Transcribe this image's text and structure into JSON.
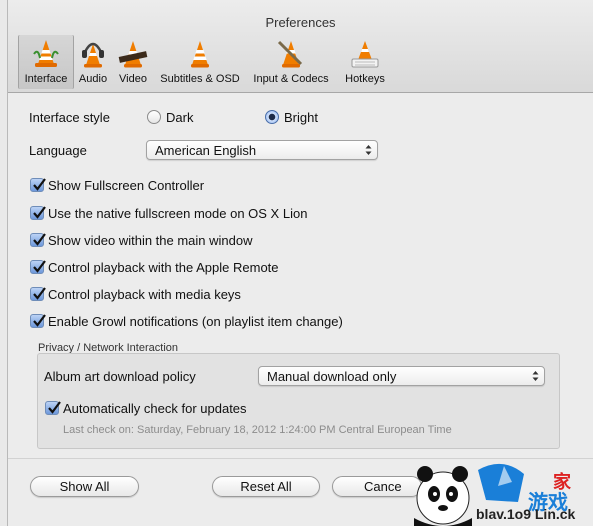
{
  "window": {
    "title": "Preferences"
  },
  "tabs": [
    {
      "label": "Interface",
      "icon": "vlc-cone-icon",
      "active": true
    },
    {
      "label": "Audio",
      "icon": "headphones-cone-icon"
    },
    {
      "label": "Video",
      "icon": "film-cone-icon"
    },
    {
      "label": "Subtitles & OSD",
      "icon": "subtitles-cone-icon"
    },
    {
      "label": "Input & Codecs",
      "icon": "codecs-cone-icon"
    },
    {
      "label": "Hotkeys",
      "icon": "keyboard-cone-icon"
    }
  ],
  "interface_style": {
    "label": "Interface style",
    "options": [
      {
        "label": "Dark",
        "selected": false
      },
      {
        "label": "Bright",
        "selected": true
      }
    ]
  },
  "language": {
    "label": "Language",
    "value": "American English"
  },
  "checkboxes": [
    {
      "label": "Show Fullscreen Controller",
      "checked": true
    },
    {
      "label": "Use the native fullscreen mode on OS X Lion",
      "checked": true
    },
    {
      "label": "Show video within the main window",
      "checked": true
    },
    {
      "label": "Control playback with the Apple Remote",
      "checked": true
    },
    {
      "label": "Control playback with media keys",
      "checked": true
    },
    {
      "label": "Enable Growl notifications (on playlist item change)",
      "checked": true
    }
  ],
  "privacy": {
    "group_title": "Privacy / Network Interaction",
    "album_art_label": "Album art download policy",
    "album_art_value": "Manual download only",
    "auto_update_label": "Automatically check for updates",
    "auto_update_checked": true,
    "last_check": "Last check on: Saturday, February 18, 2012 1:24:00 PM Central European Time"
  },
  "buttons": {
    "show_all": "Show All",
    "reset_all": "Reset All",
    "cancel": "Cance"
  },
  "watermark": {
    "text1": "家",
    "text2": "游戏",
    "text3": "blav.1o9 Lin.ck"
  },
  "colors": {
    "checkbox": "#6d98db",
    "cone_orange": "#f07d00"
  }
}
